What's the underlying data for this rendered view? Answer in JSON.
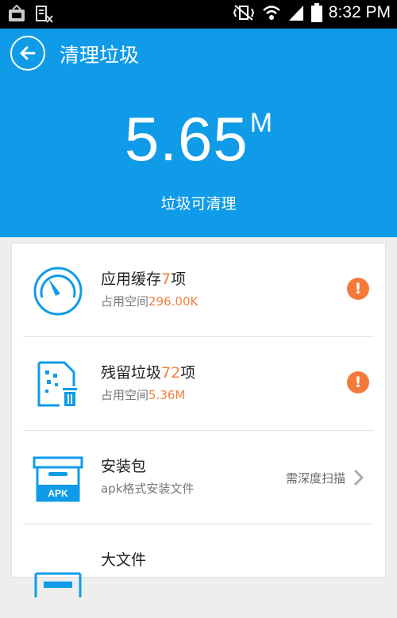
{
  "status_bar": {
    "time": "8:32 PM",
    "left_icons": [
      "cleaner-app-icon",
      "notification-icon"
    ],
    "right_icons": [
      "mute-vibrate-icon",
      "wifi-icon",
      "signal-icon",
      "battery-icon"
    ]
  },
  "header": {
    "title": "清理垃圾",
    "total_value": "5.65",
    "total_unit": "M",
    "subtitle": "垃圾可清理"
  },
  "colors": {
    "header_bg": "#0f9be8",
    "accent": "#0f9be8",
    "highlight": "#f08040",
    "warning": "#f47a3c"
  },
  "items": [
    {
      "title_prefix": "应用缓存",
      "count": "7",
      "title_suffix": "项",
      "sub_prefix": "占用空间",
      "size": "296.00K",
      "icon": "speedometer-icon",
      "status_icon": "warning-icon"
    },
    {
      "title_prefix": "残留垃圾",
      "count": "72",
      "title_suffix": "项",
      "sub_prefix": "占用空间",
      "size": "5.36M",
      "icon": "trash-file-icon",
      "status_icon": "warning-icon"
    },
    {
      "title": "安装包",
      "sub": "apk格式安装文件",
      "icon": "apk-box-icon",
      "action_label": "需深度扫描",
      "action_icon": "chevron-right-icon"
    },
    {
      "title": "大文件",
      "icon": "large-file-icon"
    }
  ]
}
